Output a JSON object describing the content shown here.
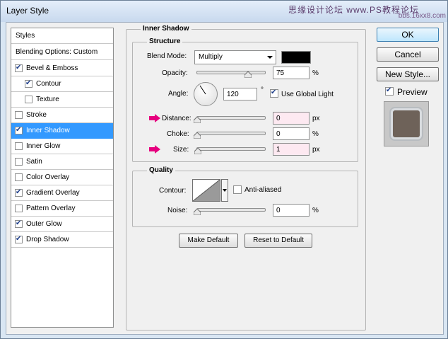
{
  "window": {
    "title": "Layer Style",
    "watermark_line1": "思缘设计论坛 www.",
    "watermark_line2": "bbs.16xx8.com",
    "watermark_ps": "PS教程论坛"
  },
  "sidebar": {
    "header": "Styles",
    "blending": "Blending Options: Custom",
    "items": [
      {
        "label": "Bevel & Emboss",
        "checked": true
      },
      {
        "label": "Contour",
        "checked": true
      },
      {
        "label": "Texture",
        "checked": false
      },
      {
        "label": "Stroke",
        "checked": false
      },
      {
        "label": "Inner Shadow",
        "checked": true
      },
      {
        "label": "Inner Glow",
        "checked": false
      },
      {
        "label": "Satin",
        "checked": false
      },
      {
        "label": "Color Overlay",
        "checked": false
      },
      {
        "label": "Gradient Overlay",
        "checked": true
      },
      {
        "label": "Pattern Overlay",
        "checked": false
      },
      {
        "label": "Outer Glow",
        "checked": true
      },
      {
        "label": "Drop Shadow",
        "checked": true
      }
    ]
  },
  "panel": {
    "section_title": "Inner Shadow",
    "structure_title": "Structure",
    "blend_mode_label": "Blend Mode:",
    "blend_mode_value": "Multiply",
    "blend_color": "#000000",
    "opacity_label": "Opacity:",
    "opacity_value": "75",
    "opacity_unit": "%",
    "angle_label": "Angle:",
    "angle_value": "120",
    "angle_unit": "°",
    "global_light_label": "Use Global Light",
    "distance_label": "Distance:",
    "distance_value": "0",
    "distance_unit": "px",
    "choke_label": "Choke:",
    "choke_value": "0",
    "choke_unit": "%",
    "size_label": "Size:",
    "size_value": "1",
    "size_unit": "px",
    "quality_title": "Quality",
    "contour_label": "Contour:",
    "anti_aliased_label": "Anti-aliased",
    "noise_label": "Noise:",
    "noise_value": "0",
    "noise_unit": "%",
    "make_default": "Make Default",
    "reset_default": "Reset to Default"
  },
  "actions": {
    "ok": "OK",
    "cancel": "Cancel",
    "new_style": "New Style...",
    "preview_label": "Preview"
  },
  "colors": {
    "selected": "#3399ff",
    "pink_arrow": "#e6007e",
    "preview_swatch": "#6e6259"
  }
}
